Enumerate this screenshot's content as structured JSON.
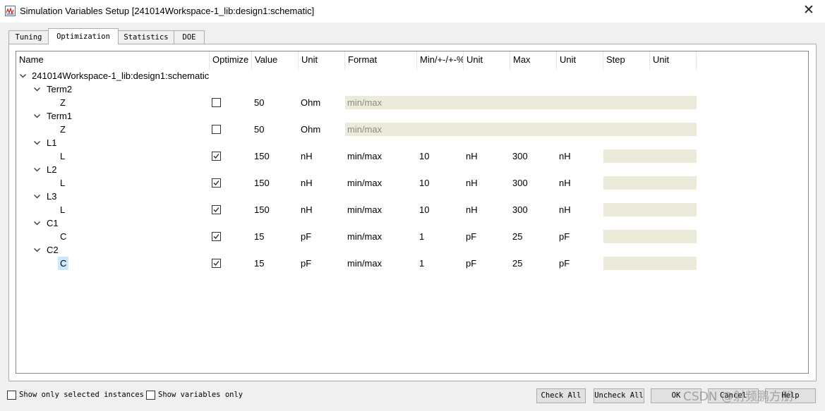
{
  "window": {
    "title": "Simulation Variables Setup [241014Workspace-1_lib:design1:schematic]",
    "close_label": "✕",
    "icon": "app-icon"
  },
  "tabs": [
    {
      "label": "Tuning",
      "active": false
    },
    {
      "label": "Optimization",
      "active": true
    },
    {
      "label": "Statistics",
      "active": false
    },
    {
      "label": "DOE",
      "active": false
    }
  ],
  "columns": [
    "Name",
    "Optimize",
    "Value",
    "Unit",
    "Format",
    "Min/+-/+-%",
    "Unit",
    "Max",
    "Unit",
    "Step",
    "Unit"
  ],
  "tree": {
    "root": "241014Workspace-1_lib:design1:schematic",
    "rows": [
      {
        "kind": "group",
        "name": "Term2"
      },
      {
        "kind": "var",
        "name": "Z",
        "checked": false,
        "value": "50",
        "unit": "Ohm",
        "format": "min/max",
        "format_placeholder": true,
        "min": "",
        "min_unit": "",
        "max": "",
        "max_unit": "",
        "step": "",
        "step_unit": "",
        "selected": false
      },
      {
        "kind": "group",
        "name": "Term1"
      },
      {
        "kind": "var",
        "name": "Z",
        "checked": false,
        "value": "50",
        "unit": "Ohm",
        "format": "min/max",
        "format_placeholder": true,
        "min": "",
        "min_unit": "",
        "max": "",
        "max_unit": "",
        "step": "",
        "step_unit": "",
        "selected": false
      },
      {
        "kind": "group",
        "name": "L1"
      },
      {
        "kind": "var",
        "name": "L",
        "checked": true,
        "value": "150",
        "unit": "nH",
        "format": "min/max",
        "format_placeholder": false,
        "min": "10",
        "min_unit": "nH",
        "max": "300",
        "max_unit": "nH",
        "step": "",
        "step_unit": "",
        "selected": false
      },
      {
        "kind": "group",
        "name": "L2"
      },
      {
        "kind": "var",
        "name": "L",
        "checked": true,
        "value": "150",
        "unit": "nH",
        "format": "min/max",
        "format_placeholder": false,
        "min": "10",
        "min_unit": "nH",
        "max": "300",
        "max_unit": "nH",
        "step": "",
        "step_unit": "",
        "selected": false
      },
      {
        "kind": "group",
        "name": "L3"
      },
      {
        "kind": "var",
        "name": "L",
        "checked": true,
        "value": "150",
        "unit": "nH",
        "format": "min/max",
        "format_placeholder": false,
        "min": "10",
        "min_unit": "nH",
        "max": "300",
        "max_unit": "nH",
        "step": "",
        "step_unit": "",
        "selected": false
      },
      {
        "kind": "group",
        "name": "C1"
      },
      {
        "kind": "var",
        "name": "C",
        "checked": true,
        "value": "15",
        "unit": "pF",
        "format": "min/max",
        "format_placeholder": false,
        "min": "1",
        "min_unit": "pF",
        "max": "25",
        "max_unit": "pF",
        "step": "",
        "step_unit": "",
        "selected": false
      },
      {
        "kind": "group",
        "name": "C2"
      },
      {
        "kind": "var",
        "name": "C",
        "checked": true,
        "value": "15",
        "unit": "pF",
        "format": "min/max",
        "format_placeholder": false,
        "min": "1",
        "min_unit": "pF",
        "max": "25",
        "max_unit": "pF",
        "step": "",
        "step_unit": "",
        "selected": true
      }
    ]
  },
  "footer": {
    "show_selected_label": "Show only selected instances",
    "show_selected_checked": false,
    "show_vars_label": "Show variables only",
    "show_vars_checked": false,
    "buttons": {
      "check_all": "Check All",
      "uncheck_all": "Uncheck All",
      "ok": "OK",
      "cancel": "Cancel",
      "help": "Help"
    }
  },
  "watermark": "CSDN @射频鹏方朋",
  "colors": {
    "shaded_cell": "#ecebdb",
    "selection": "#cce8ff"
  }
}
